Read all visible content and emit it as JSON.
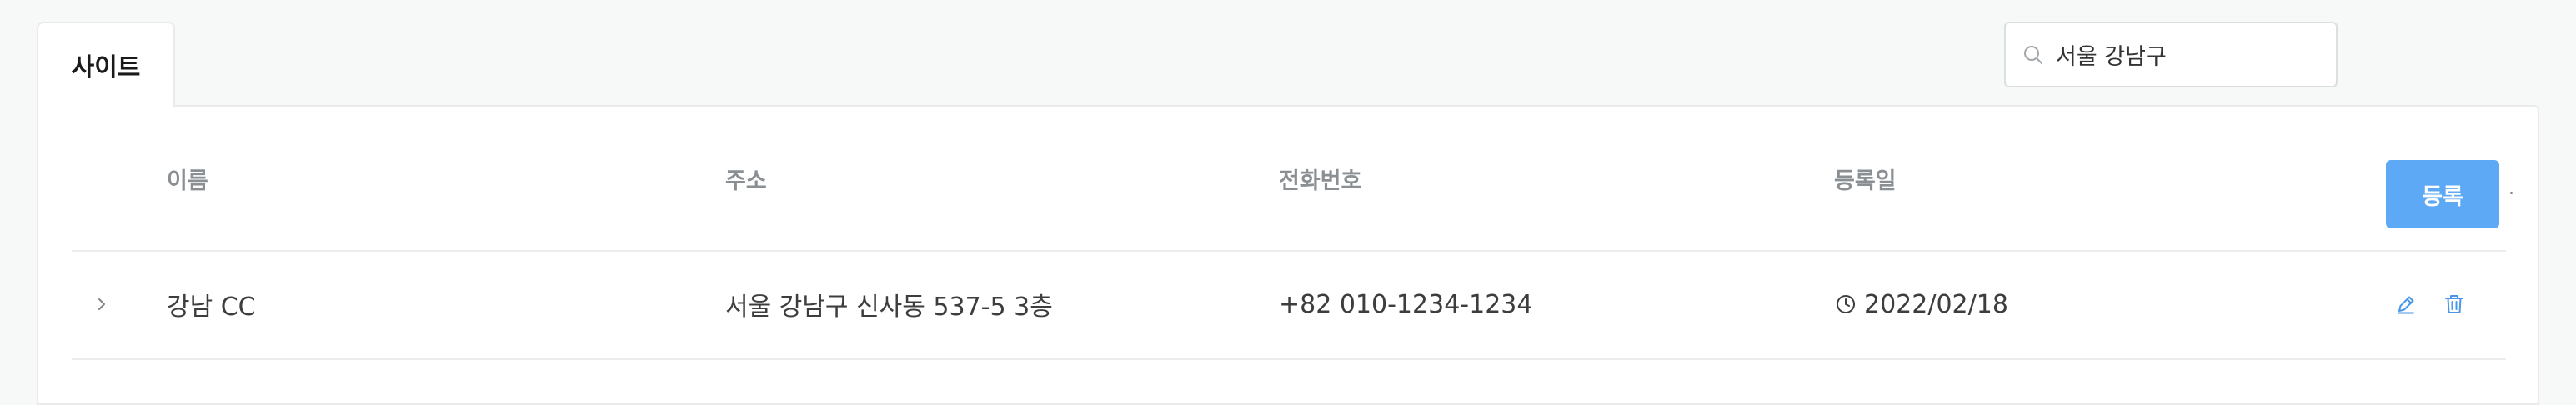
{
  "tabs": [
    {
      "label": "사이트",
      "active": true
    }
  ],
  "search": {
    "value": "서울 강남구",
    "placeholder": "",
    "icon": "search-icon"
  },
  "table": {
    "columns": [
      "이름",
      "주소",
      "전화번호",
      "등록일"
    ],
    "register_label": "등록",
    "rows": [
      {
        "name": "강남 CC",
        "address": "서울 강남구 신사동 537-5 3층",
        "phone": "+82 010-1234-1234",
        "registered": "2022/02/18",
        "icons": [
          "chevron-right-icon",
          "clock-icon",
          "edit-icon",
          "trash-icon"
        ]
      }
    ]
  },
  "colors": {
    "accent": "#5ea9f5",
    "icon_blue": "#4a96e8",
    "header_text": "#8a8f94",
    "background": "#f7f8f8"
  }
}
